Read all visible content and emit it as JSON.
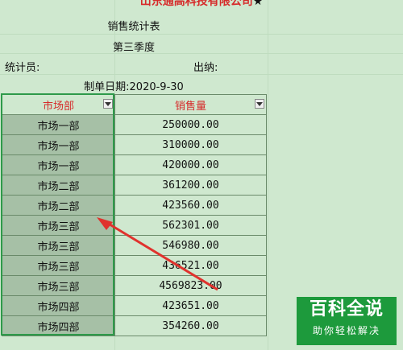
{
  "header": {
    "company": "山东通高科技有限公司",
    "star": "★",
    "report_title": "销售统计表",
    "quarter": "第三季度",
    "statistician_label": "统计员:",
    "cashier_label": "出纳:",
    "date_label": "制单日期:2020-9-30"
  },
  "table": {
    "headers": [
      "市场部",
      "销售量"
    ],
    "rows": [
      [
        "市场一部",
        "250000.00"
      ],
      [
        "市场一部",
        "310000.00"
      ],
      [
        "市场一部",
        "420000.00"
      ],
      [
        "市场二部",
        "361200.00"
      ],
      [
        "市场二部",
        "423560.00"
      ],
      [
        "市场三部",
        "562301.00"
      ],
      [
        "市场三部",
        "546980.00"
      ],
      [
        "市场三部",
        "436521.00"
      ],
      [
        "市场三部",
        "4569823.00"
      ],
      [
        "市场四部",
        "423651.00"
      ],
      [
        "市场四部",
        "354260.00"
      ]
    ]
  },
  "annotation": {
    "arrow_color": "#e0322d"
  },
  "watermark": {
    "title": "百科全说",
    "subtitle": "助你轻松解决",
    "color": "#1d9a3c"
  }
}
